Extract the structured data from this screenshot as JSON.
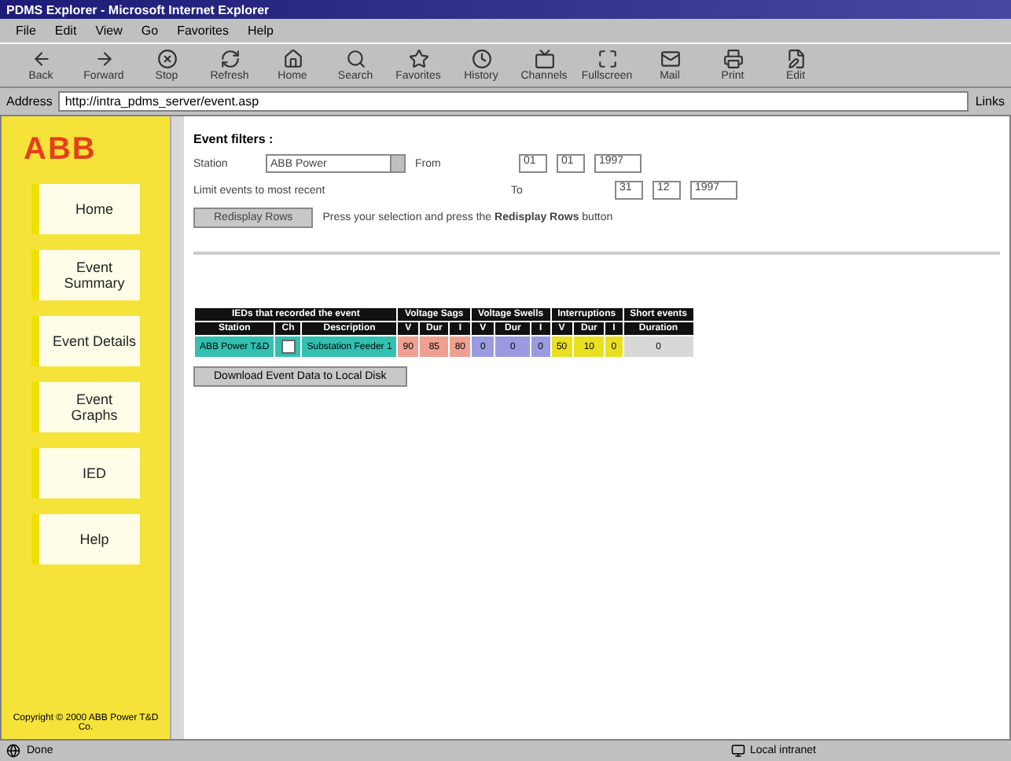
{
  "window": {
    "title": "PDMS Explorer - Microsoft Internet Explorer"
  },
  "menu": [
    "File",
    "Edit",
    "View",
    "Go",
    "Favorites",
    "Help"
  ],
  "toolbar": [
    "Back",
    "Forward",
    "Stop",
    "Refresh",
    "Home",
    "Search",
    "Favorites",
    "History",
    "Channels",
    "Fullscreen",
    "Mail",
    "Print",
    "Edit"
  ],
  "address": {
    "label": "Address",
    "value": "http://intra_pdms_server/event.asp",
    "links": "Links"
  },
  "sidebar": {
    "logo": "ABB",
    "items": [
      {
        "label": "Home",
        "selected": false
      },
      {
        "label": "Event Summary",
        "selected": false
      },
      {
        "label": "Event Details",
        "selected": false
      },
      {
        "label": "Event Graphs",
        "selected": false
      },
      {
        "label": "IED",
        "selected": false
      },
      {
        "label": "Help",
        "selected": false
      }
    ],
    "footer": "Copyright © 2000 ABB Power T&D Co."
  },
  "filters": {
    "title": "Event filters :",
    "station_label": "Station",
    "station_value": "ABB Power",
    "from_label": "From",
    "from": [
      "01",
      "01",
      "1997"
    ],
    "limit_label": "Limit events to most recent",
    "to_label": "To",
    "to": [
      "31",
      "12",
      "1997"
    ],
    "button": "Redisplay Rows",
    "hint": "Press your selection and press the **Redisplay Rows** button"
  },
  "table": {
    "groups": [
      {
        "label": "IEDs that recorded the event",
        "color": "#33c0b0",
        "columns": [
          "Station",
          "Ch",
          "Description"
        ]
      },
      {
        "label": "Voltage Sags",
        "color": "#f0a090",
        "columns": [
          "V",
          "Dur",
          "I"
        ]
      },
      {
        "label": "Voltage Swells",
        "color": "#9a9ae0",
        "columns": [
          "V",
          "Dur",
          "I"
        ]
      },
      {
        "label": "Interruptions",
        "color": "#e8e020",
        "columns": [
          "V",
          "Dur",
          "I"
        ]
      },
      {
        "label": "Short events",
        "color": "#d8d8d8",
        "columns": [
          "Duration"
        ]
      }
    ],
    "rows": [
      [
        {
          "kind": "text",
          "value": "ABB Power T&D"
        },
        {
          "kind": "checkbox",
          "checked": false
        },
        {
          "kind": "text",
          "value": "Substation Feeder 1"
        },
        {
          "kind": "text",
          "value": "90"
        },
        {
          "kind": "text",
          "value": "85"
        },
        {
          "kind": "text",
          "value": "80"
        },
        {
          "kind": "text",
          "value": "0"
        },
        {
          "kind": "text",
          "value": "0"
        },
        {
          "kind": "text",
          "value": "0"
        },
        {
          "kind": "text",
          "value": "50"
        },
        {
          "kind": "text",
          "value": "10"
        },
        {
          "kind": "text",
          "value": "0"
        },
        {
          "kind": "text",
          "value": "0"
        }
      ]
    ]
  },
  "download_button": "Download Event Data to Local Disk",
  "status_bar": {
    "text": "Done",
    "zone": "Local intranet"
  }
}
